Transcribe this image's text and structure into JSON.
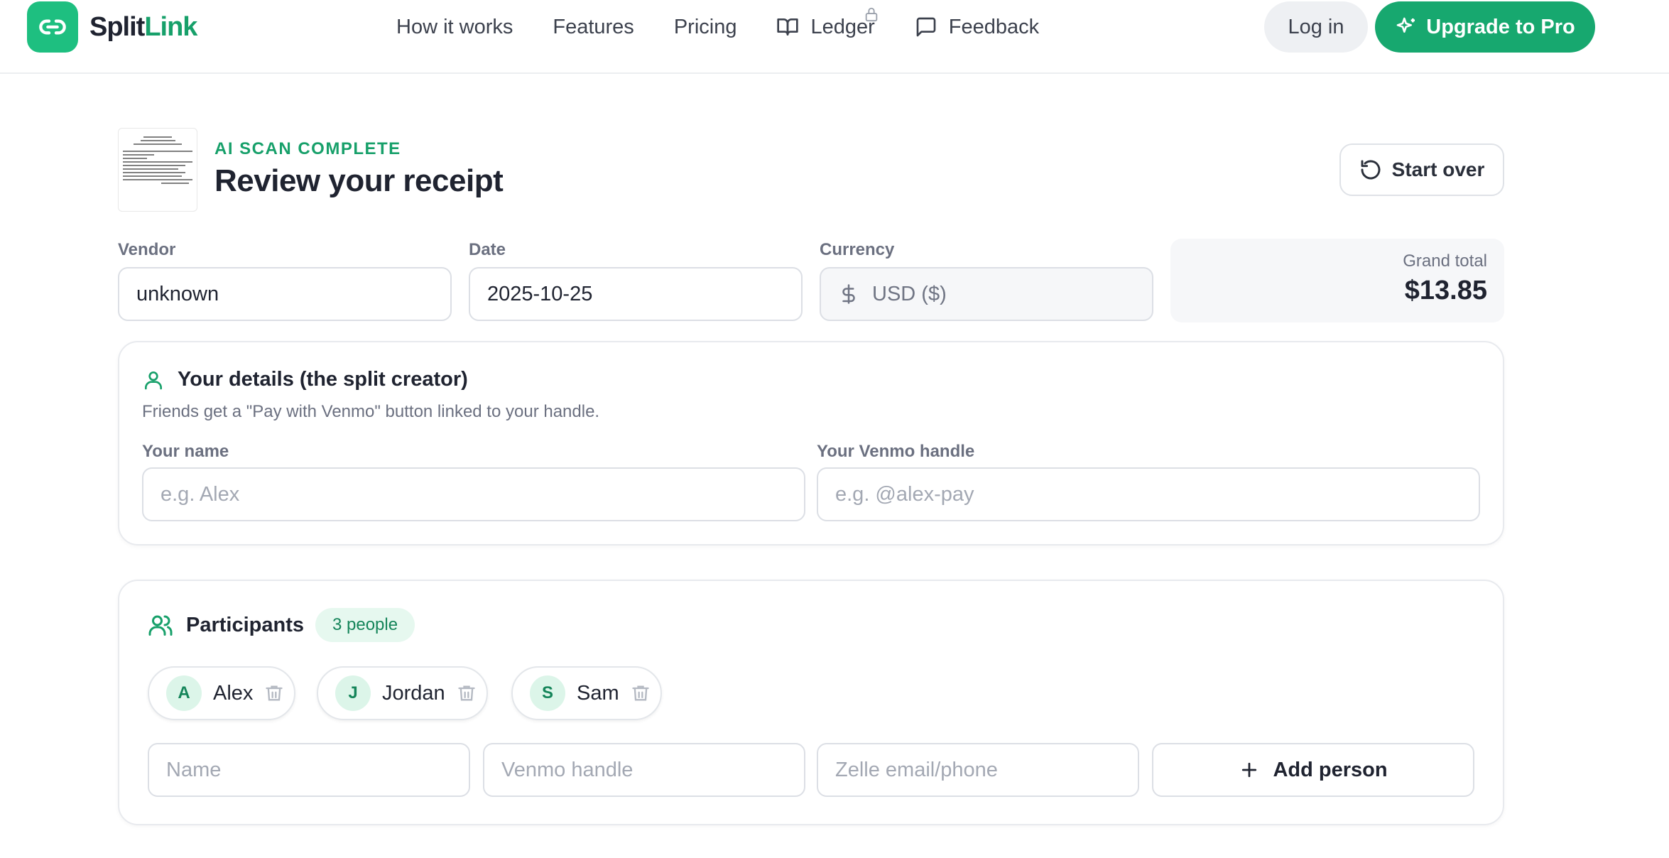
{
  "brand": {
    "name_part1": "Split",
    "name_part2": "Link"
  },
  "nav": {
    "how_it_works": "How it works",
    "features": "Features",
    "pricing": "Pricing",
    "ledger": "Ledger",
    "feedback": "Feedback"
  },
  "auth": {
    "login": "Log in",
    "upgrade": "Upgrade to Pro"
  },
  "review": {
    "eyebrow": "AI SCAN COMPLETE",
    "title": "Review your receipt",
    "start_over": "Start over"
  },
  "fields": {
    "vendor_label": "Vendor",
    "vendor_value": "unknown",
    "date_label": "Date",
    "date_value": "2025-10-25",
    "currency_label": "Currency",
    "currency_value": "USD ($)",
    "grand_total_label": "Grand total",
    "grand_total_value": "$13.85"
  },
  "creator": {
    "title": "Your details (the split creator)",
    "subtitle": "Friends get a \"Pay with Venmo\" button linked to your handle.",
    "name_label": "Your name",
    "name_placeholder": "e.g. Alex",
    "venmo_label": "Your Venmo handle",
    "venmo_placeholder": "e.g. @alex-pay"
  },
  "participants": {
    "title": "Participants",
    "count": "3 people",
    "people": [
      {
        "initial": "A",
        "name": "Alex"
      },
      {
        "initial": "J",
        "name": "Jordan"
      },
      {
        "initial": "S",
        "name": "Sam"
      }
    ],
    "name_placeholder": "Name",
    "venmo_placeholder": "Venmo handle",
    "zelle_placeholder": "Zelle email/phone",
    "add_label": "Add person"
  },
  "colors": {
    "accent": "#17a86f",
    "accent_text": "#17a06a",
    "pill_bg": "#e6f8ef"
  },
  "icons": [
    "link-icon",
    "book-icon",
    "lock-icon",
    "chat-icon",
    "sparkle-icon",
    "refresh-icon",
    "dollar-icon",
    "user-icon",
    "users-icon",
    "trash-icon",
    "plus-icon"
  ]
}
